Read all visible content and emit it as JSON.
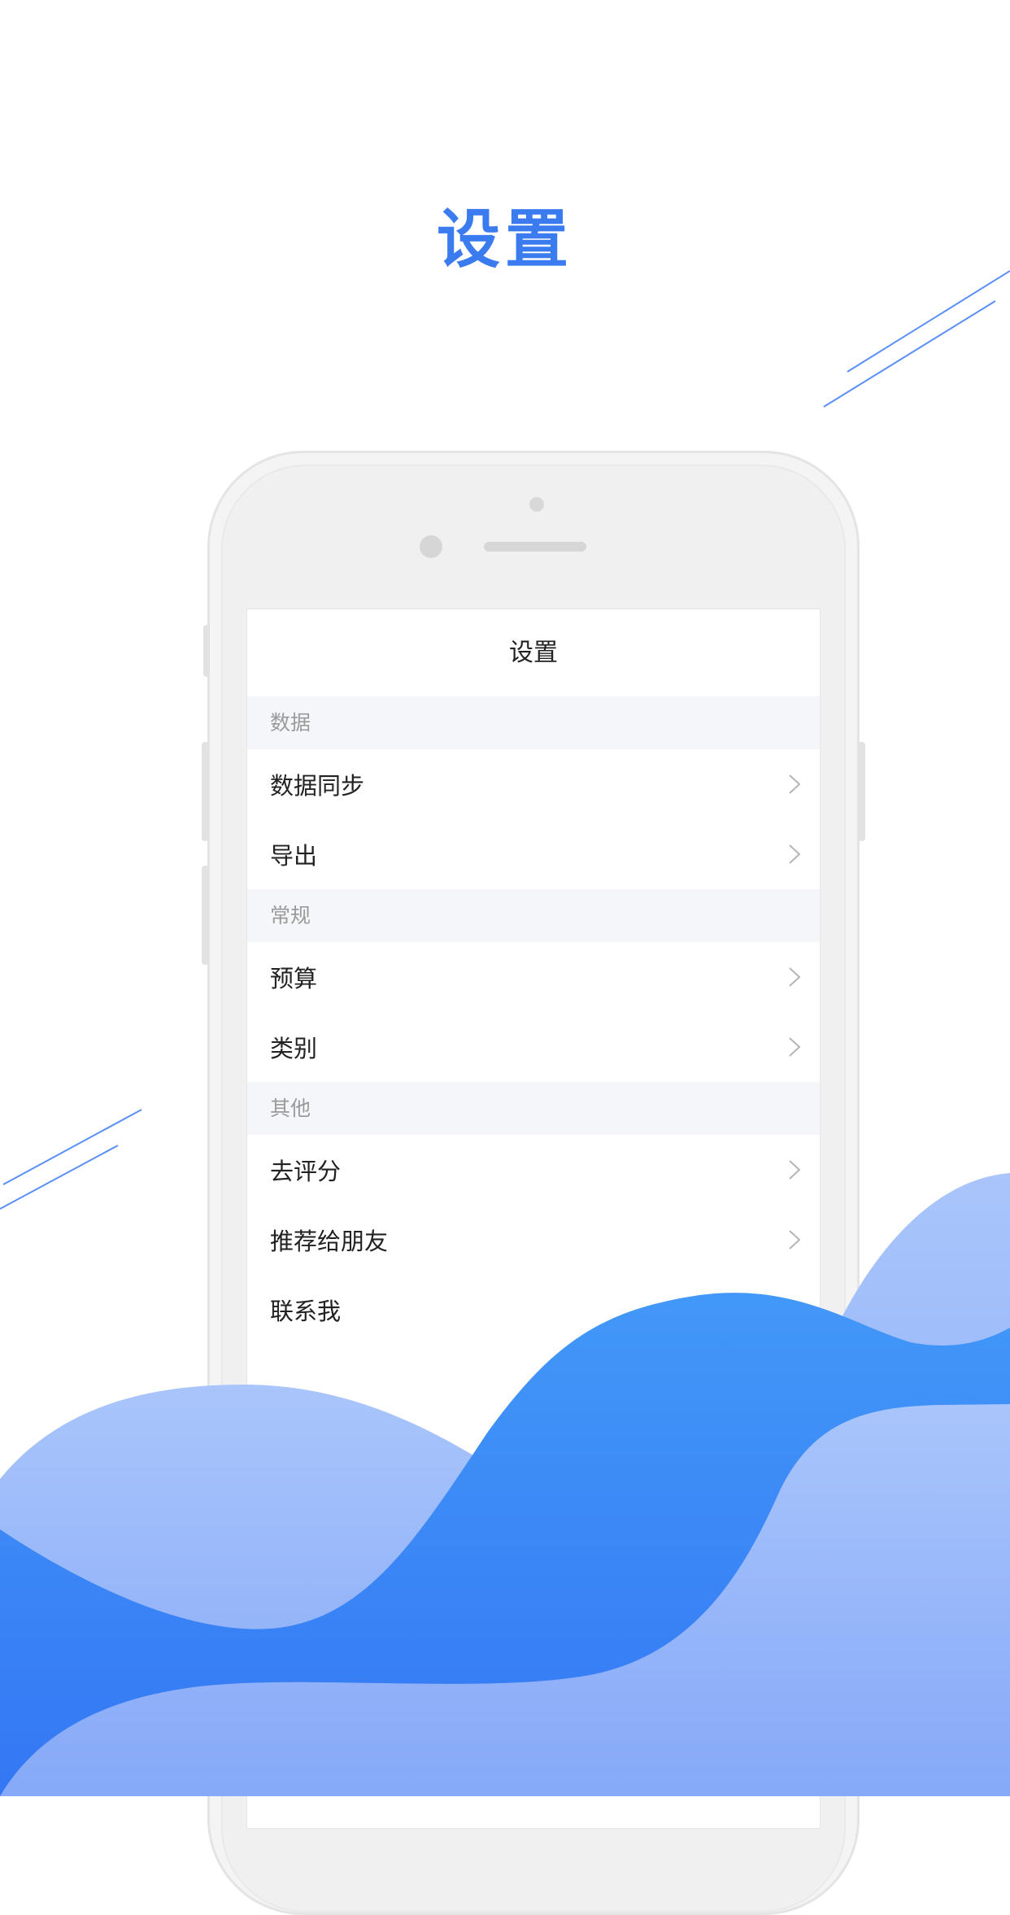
{
  "headline": "设置",
  "screen": {
    "title": "设置",
    "sections": [
      {
        "header": "数据",
        "items": [
          "数据同步",
          "导出"
        ]
      },
      {
        "header": "常规",
        "items": [
          "预算",
          "类别"
        ]
      },
      {
        "header": "其他",
        "items": [
          "去评分",
          "推荐给朋友",
          "联系我"
        ]
      }
    ]
  },
  "colors": {
    "accent": "#3a7cf0",
    "wave_light": "#9dbcfb",
    "wave_dark": "#3d86f8",
    "section_bg": "#f5f6fa"
  },
  "icons": {
    "row_action": "chevron-right-icon"
  }
}
